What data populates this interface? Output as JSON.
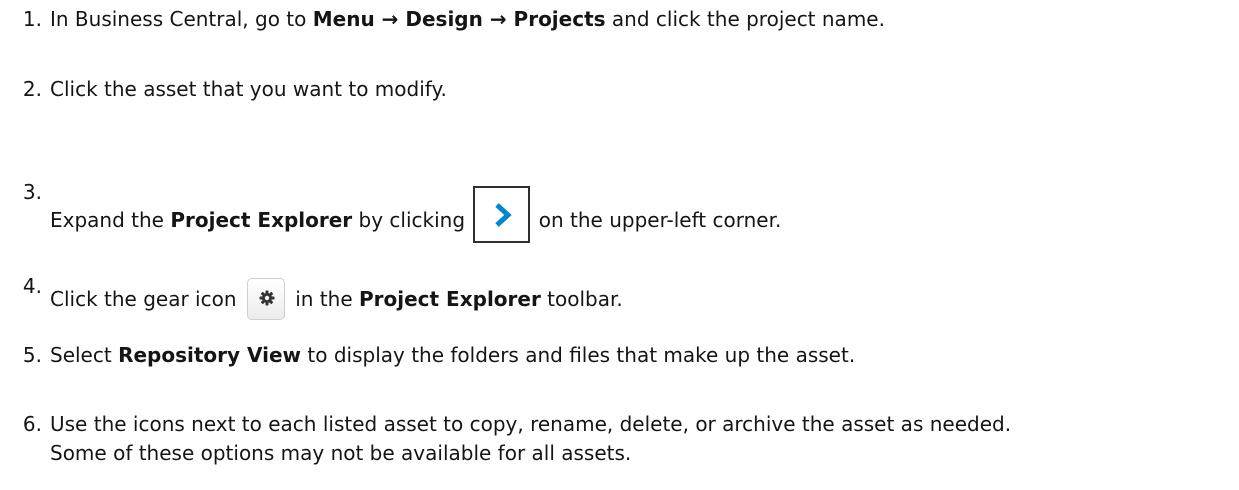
{
  "steps": [
    {
      "number": "1.",
      "prefix": "In Business Central, go to ",
      "bold": "Menu → Design → Projects",
      "suffix": " and click the project name."
    },
    {
      "number": "2.",
      "text": "Click the asset that you want to modify."
    },
    {
      "number": "3.",
      "prefix": "Expand the ",
      "bold": "Project Explorer",
      "middle": " by clicking ",
      "icon": "chevron-right-icon",
      "suffix": " on the upper-left corner."
    },
    {
      "number": "4.",
      "prefix": "Click the gear icon ",
      "icon": "gear-icon",
      "middle": " in the ",
      "bold": "Project Explorer",
      "suffix": " toolbar."
    },
    {
      "number": "5.",
      "prefix": "Select ",
      "bold": "Repository View",
      "suffix": " to display the folders and files that make up the asset."
    },
    {
      "number": "6.",
      "line1": "Use the icons next to each listed asset to copy, rename, delete, or archive the asset as needed.",
      "line2": "Some of these options may not be available for all assets."
    }
  ],
  "colors": {
    "text": "#151515",
    "chevron": "#0088ce"
  }
}
